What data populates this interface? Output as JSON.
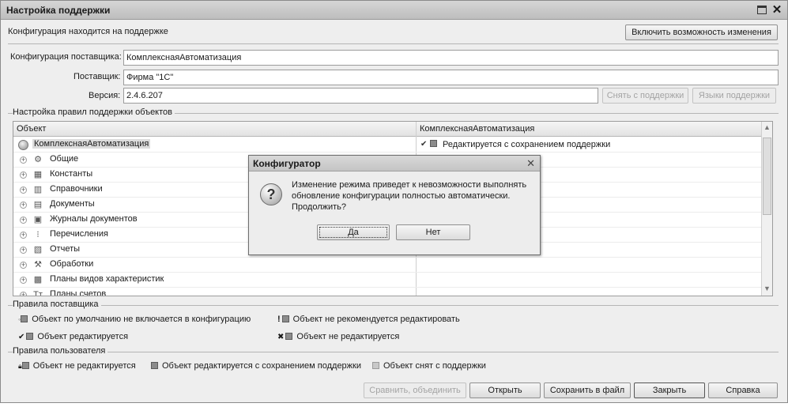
{
  "window": {
    "title": "Настройка поддержки"
  },
  "support_status": "Конфигурация находится на поддержке",
  "enable_changes_button": "Включить возможность изменения",
  "vendor_config": {
    "label": "Конфигурация поставщика:",
    "value": "КомплекснаяАвтоматизация"
  },
  "vendor": {
    "label": "Поставщик:",
    "value": "Фирма \"1С\""
  },
  "version": {
    "label": "Версия:",
    "value": "2.4.6.207"
  },
  "remove_support_button": "Снять с поддержки",
  "support_languages_button": "Языки поддержки",
  "rules_group": "Настройка правил поддержки объектов",
  "grid": {
    "headers": {
      "object": "Объект",
      "config": "КомплекснаяАвтоматизация"
    },
    "root": {
      "name": "КомплекснаяАвтоматизация",
      "rule": "Редактируется с сохранением поддержки"
    },
    "rows": [
      {
        "name": "Общие",
        "icon": "gears-icon"
      },
      {
        "name": "Константы",
        "icon": "constants-icon"
      },
      {
        "name": "Справочники",
        "icon": "catalog-icon"
      },
      {
        "name": "Документы",
        "icon": "document-icon"
      },
      {
        "name": "Журналы документов",
        "icon": "journal-icon"
      },
      {
        "name": "Перечисления",
        "icon": "enum-icon"
      },
      {
        "name": "Отчеты",
        "icon": "report-icon"
      },
      {
        "name": "Обработки",
        "icon": "processing-icon"
      },
      {
        "name": "Планы видов характеристик",
        "icon": "chart-types-icon"
      },
      {
        "name": "Планы счетов",
        "icon": "accounts-icon"
      }
    ]
  },
  "vendor_rules": {
    "title": "Правила поставщика",
    "items": [
      "Объект по умолчанию не включается в конфигурацию",
      "Объект не рекомендуется редактировать",
      "Объект редактируется",
      "Объект не редактируется"
    ]
  },
  "user_rules": {
    "title": "Правила пользователя",
    "items": [
      "Объект не редактируется",
      "Объект редактируется с сохранением поддержки",
      "Объект снят с поддержки"
    ]
  },
  "footer": {
    "compare": "Сравнить, объединить",
    "open": "Открыть",
    "save": "Сохранить в файл",
    "close": "Закрыть",
    "help": "Справка"
  },
  "dialog": {
    "title": "Конфигуратор",
    "message": "Изменение режима приведет к невозможности выполнять обновление конфигурации полностью автоматически. Продолжить?",
    "yes": "Да",
    "no": "Нет"
  }
}
